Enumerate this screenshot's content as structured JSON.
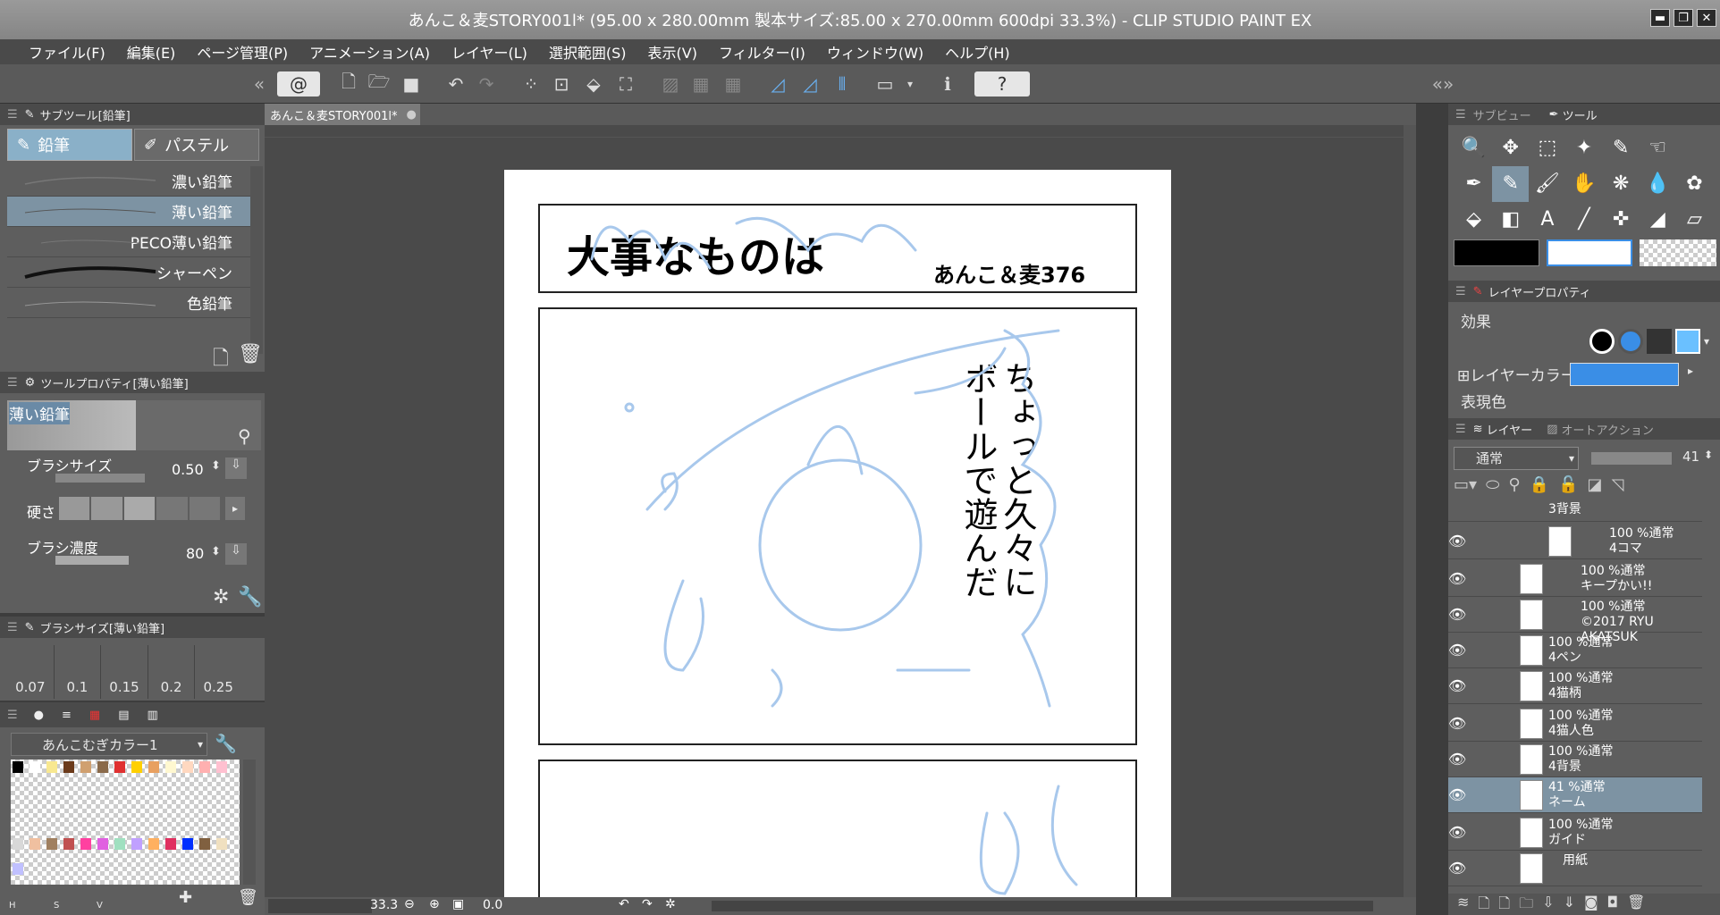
{
  "window": {
    "title": "あんこ＆麦STORY001l* (95.00 x 280.00mm 製本サイズ:85.00 x 270.00mm 600dpi 33.3%)  - CLIP STUDIO PAINT EX"
  },
  "menu": [
    "ファイル(F)",
    "編集(E)",
    "ページ管理(P)",
    "アニメーション(A)",
    "レイヤー(L)",
    "選択範囲(S)",
    "表示(V)",
    "フィルター(I)",
    "ウィンドウ(W)",
    "ヘルプ(H)"
  ],
  "subtool": {
    "title": "サブツール[鉛筆]",
    "tabs": [
      "鉛筆",
      "パステル"
    ],
    "brushes": [
      "濃い鉛筆",
      "薄い鉛筆",
      "PECO薄い鉛筆",
      "シャーペン",
      "色鉛筆"
    ]
  },
  "toolprop": {
    "title": "ツールプロパティ[薄い鉛筆]",
    "name": "薄い鉛筆",
    "brush_size_label": "ブラシサイズ",
    "brush_size": "0.50",
    "hardness_label": "硬さ",
    "density_label": "ブラシ濃度",
    "density": "80"
  },
  "brushsize": {
    "title": "ブラシサイズ[薄い鉛筆]",
    "values": [
      "0.07",
      "0.1",
      "0.15",
      "0.2",
      "0.25"
    ]
  },
  "color": {
    "set_name": "あんこむぎカラー1"
  },
  "document": {
    "tab": "あんこ＆麦STORY001l*",
    "heading": "大事なものは",
    "author": "あんこ＆麦376",
    "vertical_text_1": "ちょっと久々に",
    "vertical_text_2": "ボールで遊んだ"
  },
  "status": {
    "zoom": "33.3",
    "angle": "0.0"
  },
  "right": {
    "subview_tab": "サブビュー",
    "tool_tab": "ツール",
    "layerprop_title": "レイヤープロパティ",
    "effect": "効果",
    "layer_color": "レイヤーカラー",
    "expression": "表現色",
    "layer_tab": "レイヤー",
    "autoaction_tab": "オートアクション",
    "blend": "通常",
    "opacity": "41"
  },
  "layers": [
    {
      "l1": "3背景",
      "l2": ""
    },
    {
      "l1": "100 %通常",
      "l2": "4コマ"
    },
    {
      "l1": "100 %通常",
      "l2": "キープかい!!"
    },
    {
      "l1": "100 %通常",
      "l2": "©2017 RYU AKATSUK"
    },
    {
      "l1": "100 %通常",
      "l2": "4ペン"
    },
    {
      "l1": "100 %通常",
      "l2": "4猫柄"
    },
    {
      "l1": "100 %通常",
      "l2": "4猫人色"
    },
    {
      "l1": "100 %通常",
      "l2": "4背景"
    },
    {
      "l1": "41 %通常",
      "l2": "ネーム"
    },
    {
      "l1": "100 %通常",
      "l2": "ガイド"
    },
    {
      "l1": "用紙",
      "l2": ""
    }
  ],
  "colors": {
    "main": "#000000",
    "sub": "#ffffff",
    "layer_color": "#3a8ee6",
    "sketch": "#a8c8ec"
  }
}
